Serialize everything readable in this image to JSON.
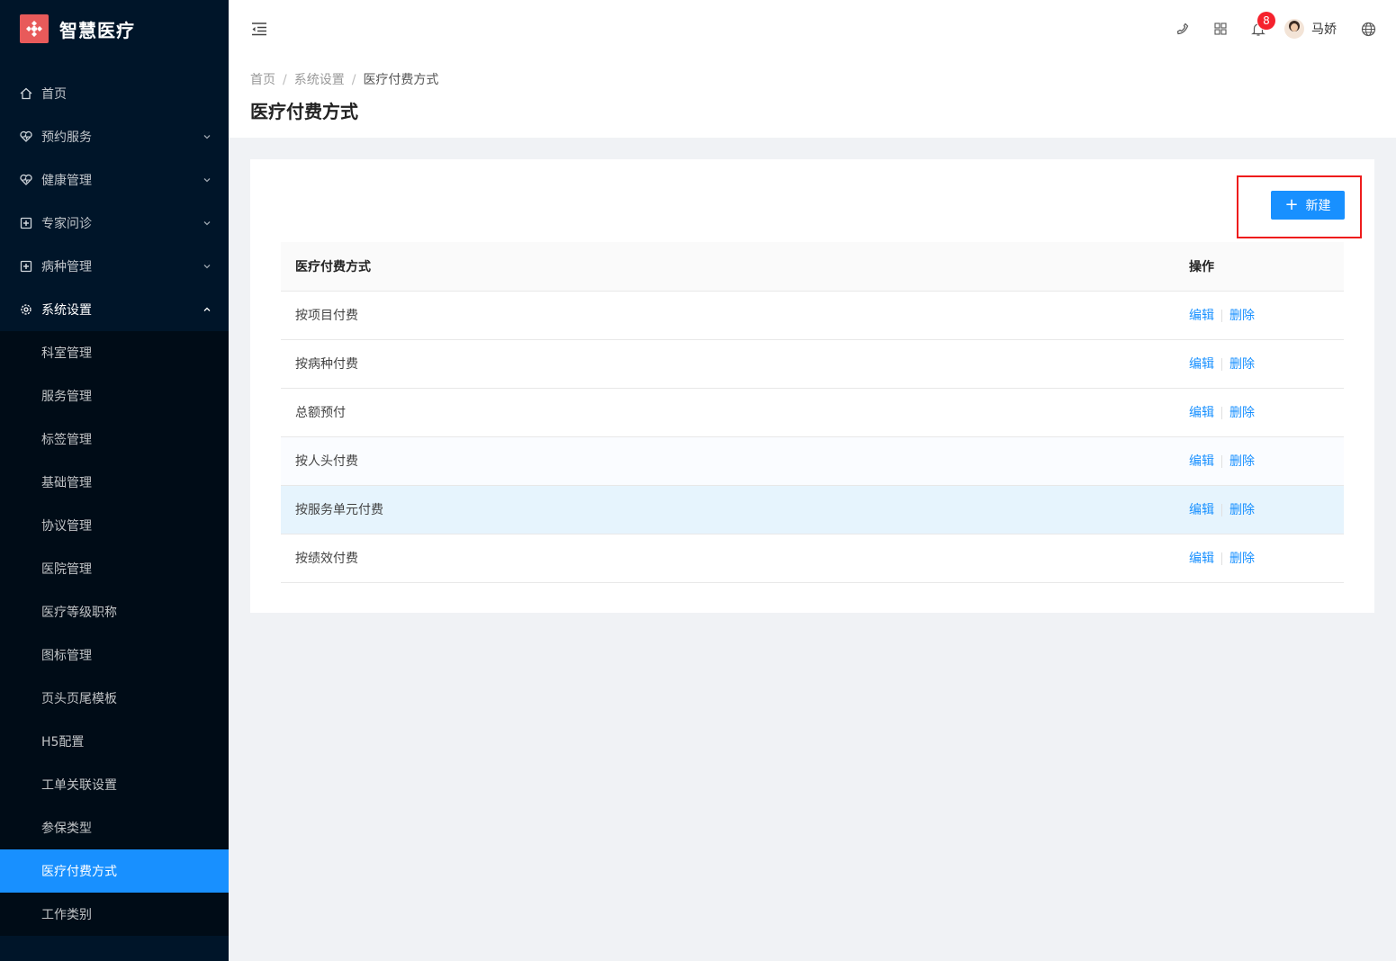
{
  "app": {
    "name": "智慧医疗",
    "brand_color": "#e85a5a",
    "accent": "#1890ff"
  },
  "sidebar": {
    "items": [
      {
        "label": "首页",
        "icon": "home-icon"
      },
      {
        "label": "预约服务",
        "icon": "heart-pulse-icon"
      },
      {
        "label": "健康管理",
        "icon": "heart-pulse-icon"
      },
      {
        "label": "专家问诊",
        "icon": "medical-plus-icon"
      },
      {
        "label": "病种管理",
        "icon": "medical-plus-icon"
      },
      {
        "label": "系统设置",
        "icon": "gear-icon"
      }
    ],
    "submenu": [
      "科室管理",
      "服务管理",
      "标签管理",
      "基础管理",
      "协议管理",
      "医院管理",
      "医疗等级职称",
      "图标管理",
      "页头页尾模板",
      "H5配置",
      "工单关联设置",
      "参保类型",
      "医疗付费方式",
      "工作类别"
    ]
  },
  "header": {
    "notification_count": "8",
    "username": "马娇"
  },
  "breadcrumb": {
    "home": "首页",
    "parent": "系统设置",
    "current": "医疗付费方式"
  },
  "page": {
    "title": "医疗付费方式"
  },
  "toolbar": {
    "new_label": "新建"
  },
  "table": {
    "columns": [
      "医疗付费方式",
      "操作"
    ],
    "rows": [
      "按项目付费",
      "按病种付费",
      "总额预付",
      "按人头付费",
      "按服务单元付费",
      "按绩效付费"
    ],
    "edit_label": "编辑",
    "delete_label": "删除"
  }
}
